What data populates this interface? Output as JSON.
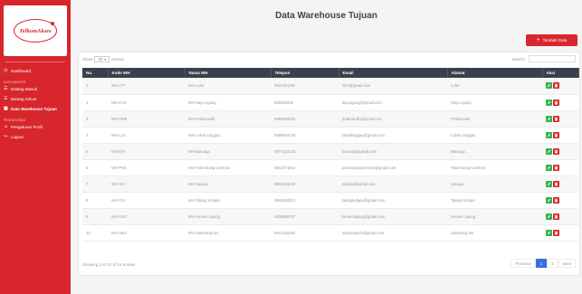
{
  "sidebar": {
    "logo_text": "TelkomAkses",
    "items": [
      {
        "type": "item",
        "label": "Dashboard",
        "icon": "dashboard-icon"
      },
      {
        "type": "heading",
        "label": "Data Master"
      },
      {
        "type": "item",
        "label": "Datang Masuk",
        "icon": "list-icon"
      },
      {
        "type": "item",
        "label": "Barang Keluar",
        "icon": "list-icon"
      },
      {
        "type": "item",
        "label": "Data Warehouse Tujuan",
        "icon": "warehouse-icon",
        "active": true
      },
      {
        "type": "heading",
        "label": "Pengaturan"
      },
      {
        "type": "item",
        "label": "Pengaturan Profil",
        "icon": "user-icon"
      },
      {
        "type": "item",
        "label": "Logout",
        "icon": "logout-icon"
      }
    ]
  },
  "header": {
    "title": "Data Warehouse Tujuan",
    "add_button": "Tambah Data"
  },
  "table_controls": {
    "show_label": "Show",
    "show_value": "10",
    "entries_label": "entries",
    "search_label": "Search:"
  },
  "table": {
    "columns": [
      "No.",
      "Kode WH",
      "Nama WH",
      "Telepon",
      "Email",
      "Alamat",
      "Aksi"
    ],
    "rows": [
      [
        "1",
        "WH LFT",
        "WH Lufut",
        "0821391392",
        "lufut@gmail.com",
        "Lufut"
      ],
      [
        "2",
        "WH KAG",
        "WH Kayu Agung",
        "086004229",
        "kayuagung@gmail.com",
        "Kayu Agung"
      ],
      [
        "3",
        "WH PBM",
        "WH Prabumulih",
        "0899334334",
        "prabumulih@gmail.com",
        "Prabumulih"
      ],
      [
        "4",
        "WH LLG",
        "WH Lubuk Linggau",
        "0899919230",
        "lubuklinggau@gmail.com",
        "Lubuk Linggau"
      ],
      [
        "5",
        "WH BTA",
        "WH Baturaja",
        "0877324334",
        "baturaja@gmail.com",
        "Baturaja"
      ],
      [
        "6",
        "WH PKE",
        "WH Palembang Centrum",
        "0813271912",
        "palembangcentrum@gmail.com",
        "Palembang Centrum"
      ],
      [
        "7",
        "WH SKY",
        "WH Sekayu",
        "0856333232",
        "sekayu@gmail.com",
        "Sekayu"
      ],
      [
        "8",
        "WH TLK",
        "WH Talang Kelapa",
        "0856333301",
        "talangkelapa@gmail.com",
        "Talang Kelapa"
      ],
      [
        "9",
        "WH KRG",
        "WH Kenten Laping",
        "0826889767",
        "kentenlaping@gmail.com",
        "Kenten Laping"
      ],
      [
        "10",
        "WH SBU",
        "WH Sukarang Ulu",
        "0821332382",
        "sukarangulu@gmail.com",
        "Sukarang Ulu"
      ]
    ]
  },
  "footer": {
    "info": "Showing 1 to 10 of 12 entries",
    "previous": "Previous",
    "page1": "1",
    "page2": "2",
    "next": "Next"
  },
  "colors": {
    "accent": "#d7262c",
    "header_dark": "#3a3f4b",
    "edit_green": "#2cb84a",
    "page_blue": "#3b6de0"
  }
}
